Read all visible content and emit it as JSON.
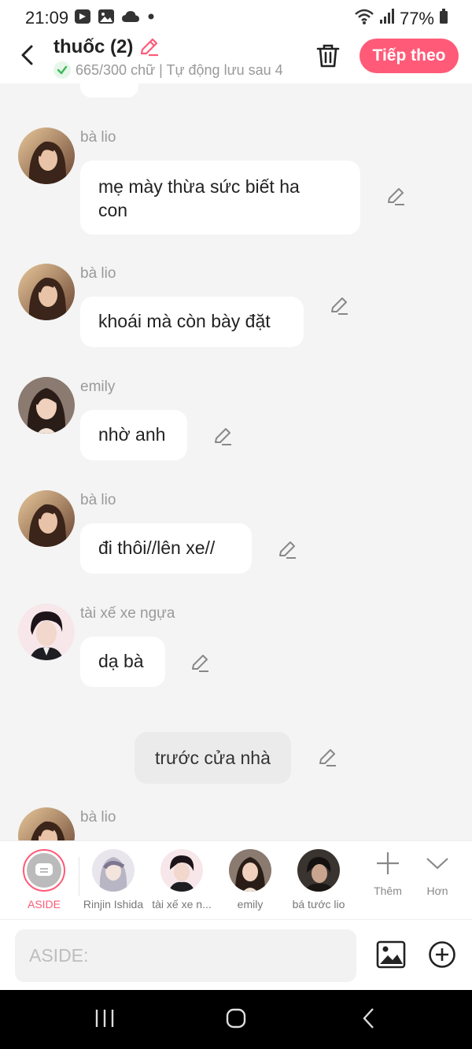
{
  "status_bar": {
    "time": "21:09",
    "battery": "77%"
  },
  "header": {
    "title": "thuốc (2)",
    "subtitle": "665/300 chữ | Tự động lưu sau 4",
    "next_label": "Tiếp theo"
  },
  "messages": [
    {
      "name": "bà lio",
      "text_lines": [
        "mẹ mày thừa sức biết ha",
        "con"
      ],
      "avatar": "woman-long-hair"
    },
    {
      "name": "bà lio",
      "text": "khoái mà còn bày đặt",
      "avatar": "woman-long-hair"
    },
    {
      "name": "emily",
      "text": "nhờ anh",
      "avatar": "woman-dark-hair"
    },
    {
      "name": "bà lio",
      "text": "đi thôi//lên xe//",
      "avatar": "woman-long-hair"
    },
    {
      "name": "tài xế xe ngựa",
      "text": "dạ bà",
      "avatar": "man-dark-hair"
    },
    {
      "name": "bà lio",
      "avatar": "woman-long-hair"
    }
  ],
  "narration": "trước cửa nhà",
  "characters": [
    {
      "label": "ASIDE",
      "selected": true
    },
    {
      "label": "Rinjin Ishida"
    },
    {
      "label": "tài xế xe n..."
    },
    {
      "label": "emily"
    },
    {
      "label": "bá tước lio"
    }
  ],
  "tools": {
    "more": "Thêm",
    "less": "Hơn"
  },
  "input": {
    "placeholder": "ASIDE:"
  },
  "colors": {
    "accent": "#ff5a78",
    "bubble": "#ffffff",
    "narration": "#ebebeb",
    "background": "#f4f4f4"
  }
}
